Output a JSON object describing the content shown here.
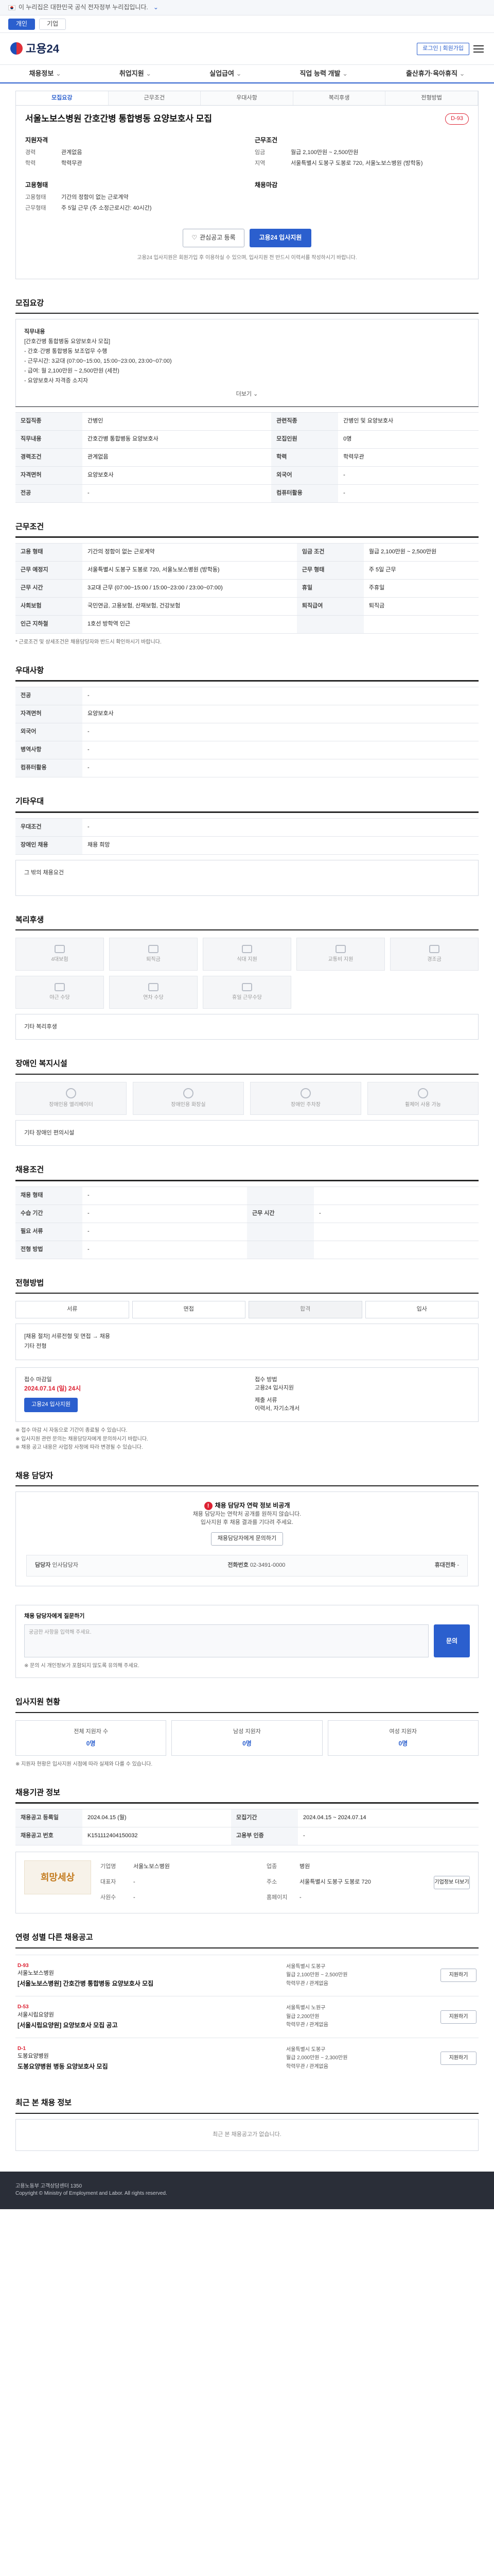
{
  "topbar": {
    "text": "이 누리집은 대한민국 공식 전자정부 누리집입니다.",
    "dropdown": "⌄"
  },
  "tabs": [
    "개인",
    "기업"
  ],
  "header": {
    "logo": "고용24",
    "login": "로그인 | 회원가입"
  },
  "gnb": [
    "채용정보",
    "취업지원",
    "실업급여",
    "직업 능력 개발",
    "출산휴가·육아휴직"
  ],
  "card": {
    "tabs": [
      "모집요강",
      "근무조건",
      "우대사항",
      "복리후생",
      "전형방법"
    ],
    "title": "서울노보스병원 간호간병 통합병동 요양보호사 모집",
    "badge": "D-93",
    "left_head": "지원자격",
    "left": [
      {
        "k": "경력",
        "v": "관계없음"
      },
      {
        "k": "학력",
        "v": "학력무관"
      }
    ],
    "right_head": "근무조건",
    "right": [
      {
        "k": "임금",
        "v": "월급 2,100만원 ~ 2,500만원"
      },
      {
        "k": "지역",
        "v": "서울특별시 도봉구 도봉로 720, 서울노보스병원 (방학동)"
      }
    ],
    "left2_head": "고용형태",
    "left2": [
      {
        "k": "고용형태",
        "v": "기간의 정함이 없는 근로계약"
      },
      {
        "k": "근무형태",
        "v": "주 5일 근무 (주 소정근로시간: 40시간)"
      }
    ],
    "right2_head": "채용마감",
    "right2": [],
    "btn_interest": "관심공고 등록",
    "btn_apply": "고용24 입사지원",
    "notice": "고용24 입사지원은 회원가입 후 이용하실 수 있으며, 입사지원 전 반드시 이력서를 작성하시기 바랍니다."
  },
  "recruit": {
    "title": "모집요강",
    "box_head": "직무내용",
    "lines": [
      "[간호간병 통합병동 요양보호사 모집]",
      "- 간호·간병 통합병동 보조업무 수행",
      "- 근무시간: 3교대 (07:00~15:00, 15:00~23:00, 23:00~07:00)",
      "- 급여: 월 2,100만원 ~ 2,500만원 (세전)",
      "- 요양보호사 자격증 소지자"
    ],
    "more": "더보기 ⌄",
    "rows": [
      {
        "k": "모집직종",
        "v": "간병인",
        "k2": "관련직종",
        "v2": "간병인 및 요양보호사"
      },
      {
        "k": "직무내용",
        "v": "간호간병 통합병동 요양보호사",
        "k2": "모집인원",
        "v2": "0명"
      },
      {
        "k": "경력조건",
        "v": "관계없음",
        "k2": "학력",
        "v2": "학력무관"
      },
      {
        "k": "자격면허",
        "v": "요양보호사",
        "k2": "외국어",
        "v2": "-"
      },
      {
        "k": "전공",
        "v": "-",
        "k2": "컴퓨터활용",
        "v2": "-"
      }
    ]
  },
  "conditions": {
    "title": "근무조건",
    "rows": [
      {
        "k": "고용 형태",
        "v": "기간의 정함이 없는 근로계약",
        "k2": "임금 조건",
        "v2": "월급 2,100만원 ~ 2,500만원"
      },
      {
        "k": "근무 예정지",
        "v": "서울특별시 도봉구 도봉로 720, 서울노보스병원 (방학동)",
        "k2": "근무 형태",
        "v2": "주 5일 근무"
      },
      {
        "k": "근무 시간",
        "v": "3교대 근무 (07:00~15:00 / 15:00~23:00 / 23:00~07:00)",
        "k2": "휴일",
        "v2": "주휴일"
      },
      {
        "k": "사회보험",
        "v": "국민연금, 고용보험, 산재보험, 건강보험",
        "k2": "퇴직급여",
        "v2": "퇴직금"
      },
      {
        "k": "인근 지하철",
        "v": "1호선 방학역 인근",
        "k2": "",
        "v2": ""
      }
    ],
    "note": "* 근로조건 및 상세조건은 채용담당자와 반드시 확인하시기 바랍니다."
  },
  "preference": {
    "title": "우대사항",
    "rows": [
      {
        "k": "전공",
        "v": "-"
      },
      {
        "k": "자격면허",
        "v": "요양보호사"
      },
      {
        "k": "외국어",
        "v": "-"
      },
      {
        "k": "병역사항",
        "v": "-"
      },
      {
        "k": "컴퓨터활용",
        "v": "-"
      }
    ]
  },
  "other": {
    "title": "기타우대",
    "rows": [
      {
        "k": "우대조건",
        "v": "-"
      },
      {
        "k": "장애인 채용",
        "v": "채용 희망"
      }
    ],
    "extra_label": "그 밖의 채용요건"
  },
  "welfare": {
    "title": "복리후생",
    "items": [
      "4대보험",
      "퇴직금",
      "식대 지원",
      "교통비 지원",
      "경조금",
      "야근 수당",
      "연차 수당",
      "휴일 근무수당",
      "",
      ""
    ],
    "extra_label": "기타 복리후생"
  },
  "disability": {
    "title": "장애인 복지시설",
    "items": [
      "장애인용 엘리베이터",
      "장애인용 화장실",
      "장애인 주차장",
      "휠체어 사용 가능"
    ],
    "extra_label": "기타 장애인 편의시설"
  },
  "condition2": {
    "title": "채용조건",
    "rows": [
      {
        "k": "채용 형태",
        "v": "-",
        "k2": "",
        "v2": ""
      },
      {
        "k": "수습 기간",
        "v": "-",
        "k2": "근무 시간",
        "v2": "-"
      },
      {
        "k": "필요 서류",
        "v": "-",
        "k2": "",
        "v2": ""
      },
      {
        "k": "전형 방법",
        "v": "-",
        "k2": "",
        "v2": ""
      }
    ]
  },
  "process": {
    "title": "전형방법",
    "steps": [
      "서류",
      "면접",
      "합격",
      "입사"
    ],
    "box_lines": [
      "[채용 절차] 서류전형 및 면접 → 채용",
      "기타 전형"
    ],
    "deadline_label": "접수 마감일",
    "deadline": "2024.07.14 (일) 24시",
    "apply_label": "접수 방법",
    "apply_method": "고용24 입사지원",
    "btn": "고용24 입사지원",
    "docs_label": "제출 서류",
    "docs": "이력서, 자기소개서",
    "notes": [
      "※ 접수 마감 시 자동으로 기간이 종료될 수 있습니다.",
      "※ 입사지원 관련 문의는 채용담당자에게 문의하시기 바랍니다.",
      "※ 채용 공고 내용은 사업장 사정에 따라 변경될 수 있습니다."
    ]
  },
  "manager": {
    "title": "채용 담당자",
    "warn_title": "채용 담당자 연락 정보 비공개",
    "warn_lines": [
      "채용 담당자는 연락처 공개를 원하지 않습니다.",
      "입사지원 후 채용 결과를 기다려 주세요."
    ],
    "btn": "채용담당자에게 문의하기",
    "contact_k1": "담당자",
    "contact_v1": "인사담당자",
    "contact_k2": "전화번호",
    "contact_v2": "02-3491-0000",
    "contact_k3": "휴대전화",
    "contact_v3": "-"
  },
  "inquiry": {
    "title": "채용 담당자에게 질문하기",
    "placeholder": "궁금한 사항을 입력해 주세요.",
    "btn": "문의",
    "note": "※ 문의 시 개인정보가 포함되지 않도록 유의해 주세요."
  },
  "apply": {
    "title": "입사지원 현황",
    "items": [
      {
        "label": "전체 지원자 수",
        "value": "0명"
      },
      {
        "label": "남성 지원자",
        "value": "0명"
      },
      {
        "label": "여성 지원자",
        "value": "0명"
      }
    ],
    "note": "※ 지원자 현황은 입사지원 시점에 따라 실제와 다를 수 있습니다."
  },
  "recruit_info": {
    "title": "채용기관 정보",
    "rows": [
      {
        "k": "채용공고 등록일",
        "v": "2024.04.15 (월)",
        "k2": "모집기간",
        "v2": "2024.04.15 ~ 2024.07.14"
      },
      {
        "k": "채용공고 번호",
        "v": "K151112404150032",
        "k2": "고용부 인증",
        "v2": "-"
      }
    ]
  },
  "company": {
    "logo": "희망세상",
    "rows": [
      {
        "k": "기업명",
        "v": "서울노보스병원"
      },
      {
        "k": "업종",
        "v": "병원"
      },
      {
        "k": "대표자",
        "v": "-"
      },
      {
        "k": "주소",
        "v": "서울특별시 도봉구 도봉로 720"
      },
      {
        "k": "사원수",
        "v": "-"
      },
      {
        "k": "홈페이지",
        "v": "-"
      }
    ],
    "btn": "기업정보 더보기"
  },
  "similar": {
    "title": "연령 성별 다른 채용공고",
    "items": [
      {
        "d": "D-93",
        "co": "서울노보스병원",
        "title": "[서울노보스병원] 간호간병 통합병동 요양보호사 모집",
        "meta": [
          "서울특별시 도봉구",
          "월급 2,100만원 ~ 2,500만원",
          "학력무관 / 관계없음"
        ],
        "btn": "지원하기"
      },
      {
        "d": "D-53",
        "co": "서울시립요양원",
        "title": "[서울시립요양원] 요양보호사 모집 공고",
        "meta": [
          "서울특별시 노원구",
          "월급 2,200만원",
          "학력무관 / 관계없음"
        ],
        "btn": "지원하기"
      },
      {
        "d": "D-1",
        "co": "도봉요양병원",
        "title": "도봉요양병원 병동 요양보호사 모집",
        "meta": [
          "서울특별시 도봉구",
          "월급 2,000만원 ~ 2,300만원",
          "학력무관 / 관계없음"
        ],
        "btn": "지원하기"
      }
    ]
  },
  "recent": {
    "title": "최근 본 채용 정보",
    "empty": "최근 본 채용공고가 없습니다."
  },
  "footer": {
    "line1": "고용노동부 고객상담센터 1350",
    "line2": "Copyright © Ministry of Employment and Labor. All rights reserved."
  }
}
